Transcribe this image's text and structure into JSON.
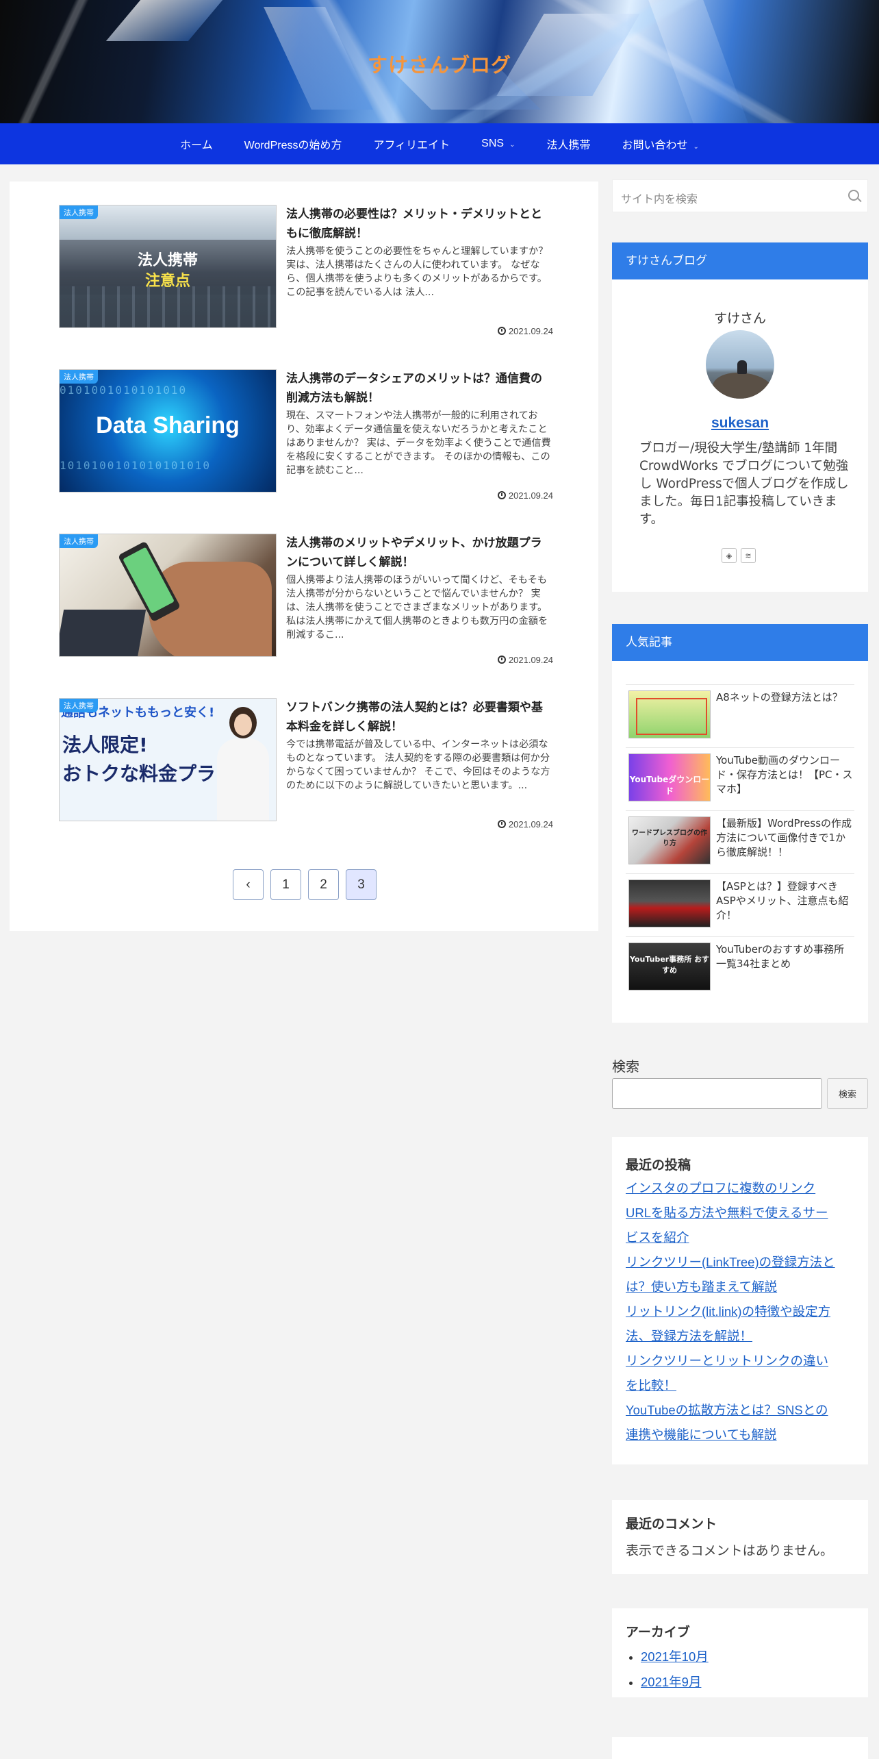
{
  "site": {
    "title": "すけさんブログ"
  },
  "nav": {
    "items": [
      {
        "label": "ホーム"
      },
      {
        "label": "WordPressの始め方"
      },
      {
        "label": "アフィリエイト"
      },
      {
        "label": "SNS",
        "has_dropdown": true
      },
      {
        "label": "法人携帯"
      },
      {
        "label": "お問い合わせ",
        "has_dropdown": true
      }
    ]
  },
  "articles": [
    {
      "category": "法人携帯",
      "title": "法人携帯の必要性は？メリット・デメリットとともに徹底解説！",
      "snippet": "法人携帯を使うことの必要性をちゃんと理解していますか？ 実は、法人携帯はたくさんの人に使われています。 なぜなら、個人携帯を使うよりも多くのメリットがあるからです。 この記事を読んでいる人は 法人...",
      "date": "2021.09.24",
      "thumb_lines": [
        "法人携帯",
        "注意点"
      ]
    },
    {
      "category": "法人携帯",
      "title": "法人携帯のデータシェアのメリットは？通信費の削減方法も解説！",
      "snippet": "現在、スマートフォンや法人携帯が一般的に利用されており、効率よくデータ通信量を使えないだろうかと考えたことはありませんか？ 実は、データを効率よく使うことで通信費を格段に安くすることができます。 そのほかの情報も、この記事を読むこと...",
      "date": "2021.09.24",
      "thumb_lines": [
        "Data Sharing"
      ]
    },
    {
      "category": "法人携帯",
      "title": "法人携帯のメリットやデメリット、かけ放題プランについて詳しく解説！",
      "snippet": "個人携帯より法人携帯のほうがいいって聞くけど、そもそも法人携帯が分からないということで悩んでいませんか？ 実は、法人携帯を使うことでさまざまなメリットがあります。 私は法人携帯にかえて個人携帯のときよりも数万円の金額を削減するこ...",
      "date": "2021.09.24",
      "thumb_lines": []
    },
    {
      "category": "法人携帯",
      "title": "ソフトバンク携帯の法人契約とは？必要書類や基本料金を詳しく解説！",
      "snippet": "今では携帯電話が普及している中、インターネットは必須なものとなっています。 法人契約をする際の必要書類は何か分からなくて困っていませんか？ そこで、今回はそのような方のために以下のように解説していきたいと思います。...",
      "date": "2021.09.24",
      "thumb_lines": [
        "通話もネットももっと安く!",
        "法人限定!",
        "おトクな料金プラン!!"
      ]
    }
  ],
  "pagination": {
    "prev": "‹",
    "pages": [
      "1",
      "2",
      "3"
    ],
    "current": "3"
  },
  "sidebar": {
    "search_placeholder": "サイト内を検索",
    "profile": {
      "heading": "すけさんブログ",
      "name": "すけさん",
      "link": "sukesan",
      "bio": "ブロガー/現役大学生/塾講師 1年間CrowdWorks でブログについて勉強し WordPressで個人ブログを作成しました。毎日1記事投稿していきます。"
    },
    "popular": {
      "heading": "人気記事",
      "items": [
        {
          "title": "A8ネットの登録方法とは？",
          "thumb_text": ""
        },
        {
          "title": "YouTube動画のダウンロード・保存方法とは！【PC・スマホ】",
          "thumb_text": "YouTubeダウンロード"
        },
        {
          "title": "【最新版】WordPressの作成方法について画像付きで1から徹底解説！！",
          "thumb_text": "ワードプレスブログの作り方"
        },
        {
          "title": "【ASPとは？】登録すべきASPやメリット、注意点も紹介！",
          "thumb_text": ""
        },
        {
          "title": "YouTuberのおすすめ事務所一覧34社まとめ",
          "thumb_text": "YouTuber事務所 おすすめ"
        }
      ]
    },
    "search_widget": {
      "label": "検索",
      "button": "検索"
    },
    "recent_posts": {
      "heading": "最近の投稿",
      "lines": [
        "インスタのプロフに複数のリンク",
        "URLを貼る方法や無料で使えるサー",
        "ビスを紹介",
        "リンクツリー(LinkTree)の登録方法と",
        "は？使い方も踏まえて解説",
        "リットリンク(lit.link)の特徴や設定方",
        "法、登録方法を解説！",
        "リンクツリーとリットリンクの違い",
        "を比較！",
        "YouTubeの拡散方法とは？SNSとの",
        "連携や機能についても解説"
      ]
    },
    "recent_comments": {
      "heading": "最近のコメント",
      "empty": "表示できるコメントはありません。"
    },
    "archives": {
      "heading": "アーカイブ",
      "items": [
        "2021年10月",
        "2021年9月"
      ]
    }
  }
}
